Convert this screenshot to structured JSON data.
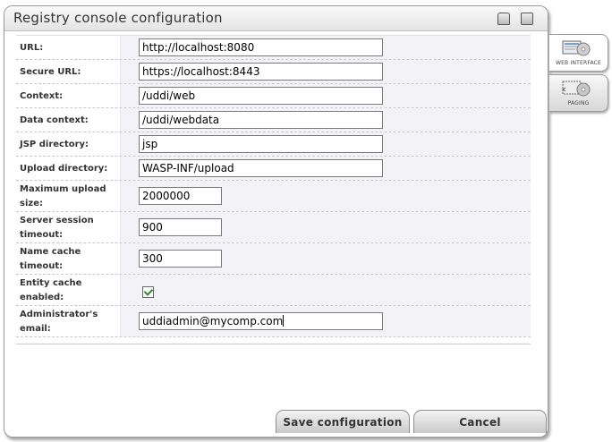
{
  "window": {
    "title": "Registry console configuration",
    "icons": [
      "printer-icon",
      "exit-door-icon"
    ]
  },
  "tabs": [
    {
      "label": "WEB INTERFACE",
      "icon": "monitor-disc-icon",
      "active": true
    },
    {
      "label": "PAGING",
      "icon": "pages-disc-icon",
      "active": false
    }
  ],
  "form": {
    "url_label": "URL:",
    "url_value": "http://localhost:8080",
    "secure_url_label": "Secure URL:",
    "secure_url_value": "https://localhost:8443",
    "context_label": "Context:",
    "context_value": "/uddi/web",
    "data_context_label": "Data context:",
    "data_context_value": "/uddi/webdata",
    "jsp_dir_label": "JSP directory:",
    "jsp_dir_value": "jsp",
    "upload_dir_label": "Upload directory:",
    "upload_dir_value": "WASP-INF/upload",
    "max_upload_label": "Maximum upload size:",
    "max_upload_value": "2000000",
    "session_timeout_label": "Server session timeout:",
    "session_timeout_value": "900",
    "name_cache_label": "Name cache timeout:",
    "name_cache_value": "300",
    "entity_cache_label": "Entity cache enabled:",
    "entity_cache_checked": true,
    "admin_email_label": "Administrator's email:",
    "admin_email_value": "uddiadmin@mycomp.com"
  },
  "buttons": {
    "save_label": "Save configuration",
    "cancel_label": "Cancel"
  },
  "colors": {
    "field_column_bg": "#f2f2f7",
    "checkbox_check": "#2a8a2a"
  }
}
